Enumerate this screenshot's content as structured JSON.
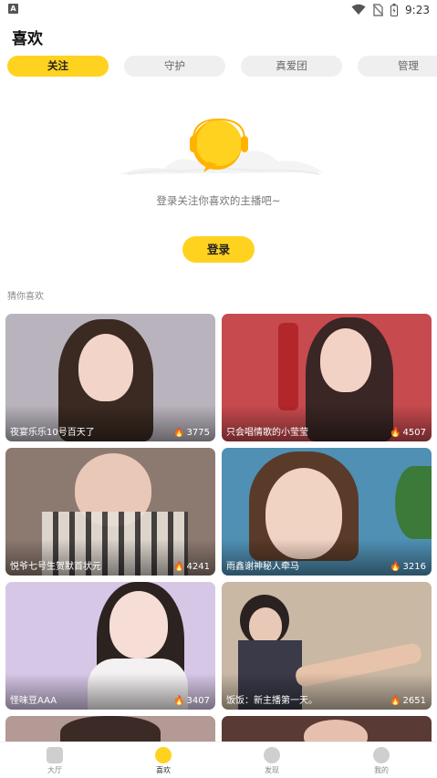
{
  "status_bar": {
    "badge": "A",
    "time": "9:23"
  },
  "page_title": "喜欢",
  "tabs": [
    {
      "label": "关注",
      "active": true
    },
    {
      "label": "守护",
      "active": false
    },
    {
      "label": "真爱团",
      "active": false
    },
    {
      "label": "管理",
      "active": false
    }
  ],
  "empty_state": {
    "message": "登录关注你喜欢的主播吧~",
    "login_label": "登录"
  },
  "recommend": {
    "title": "猜你喜欢",
    "cards": [
      {
        "name": "夜宴乐乐10号百天了",
        "heat": "3775",
        "bg": "#b9b3bd"
      },
      {
        "name": "只会唱情歌的小莹莹",
        "heat": "4507",
        "bg": "#c74a4e"
      },
      {
        "name": "悦爷七号生贺默首状元",
        "heat": "4241",
        "bg": "#8c7a70"
      },
      {
        "name": "雨鑫谢神秘人牵马",
        "heat": "3216",
        "bg": "#4f90b4"
      },
      {
        "name": "怪味豆AAA",
        "heat": "3407",
        "bg": "#d6c7e6"
      },
      {
        "name": "饭饭：新主播第一天。",
        "heat": "2651",
        "bg": "#c9b8a4"
      }
    ]
  },
  "bottom_nav": [
    {
      "label": "大厅",
      "icon": "lobby-icon",
      "active": false
    },
    {
      "label": "喜欢",
      "icon": "star-icon",
      "active": true
    },
    {
      "label": "发现",
      "icon": "compass-icon",
      "active": false
    },
    {
      "label": "我的",
      "icon": "profile-icon",
      "active": false
    }
  ],
  "colors": {
    "accent": "#ffd21f"
  }
}
